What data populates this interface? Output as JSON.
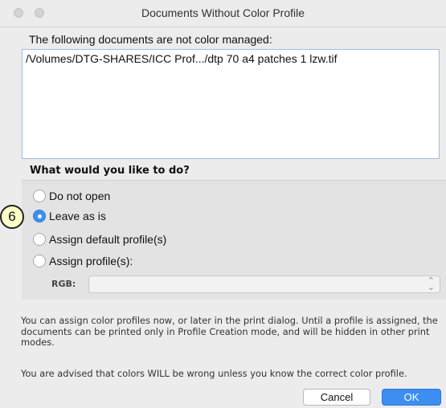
{
  "window": {
    "title": "Documents Without Color Profile"
  },
  "documents": {
    "label": "The following documents are not color managed:",
    "items": [
      "/Volumes/DTG-SHARES/ICC Prof.../dtp 70 a4 patches 1 lzw.tif"
    ]
  },
  "options": {
    "question": "What would you like to do?",
    "radios": [
      {
        "label": "Do not open",
        "selected": false
      },
      {
        "label": "Leave as is",
        "selected": true
      },
      {
        "label": "Assign default profile(s)",
        "selected": false
      },
      {
        "label": "Assign profile(s):",
        "selected": false
      }
    ],
    "rgb_label": "RGB:",
    "rgb_value": ""
  },
  "info_text": "You can assign color profiles now, or later in the print dialog. Until a profile is assigned, the documents can be printed only in Profile Creation mode, and will be hidden in other print modes.",
  "warning_text": "You are advised that colors WILL be wrong unless you know the correct color profile.",
  "buttons": {
    "cancel": "Cancel",
    "ok": "OK"
  },
  "callout": {
    "number": "6"
  },
  "colors": {
    "accent": "#3d8ef0",
    "callout_fill": "#fffec8"
  }
}
